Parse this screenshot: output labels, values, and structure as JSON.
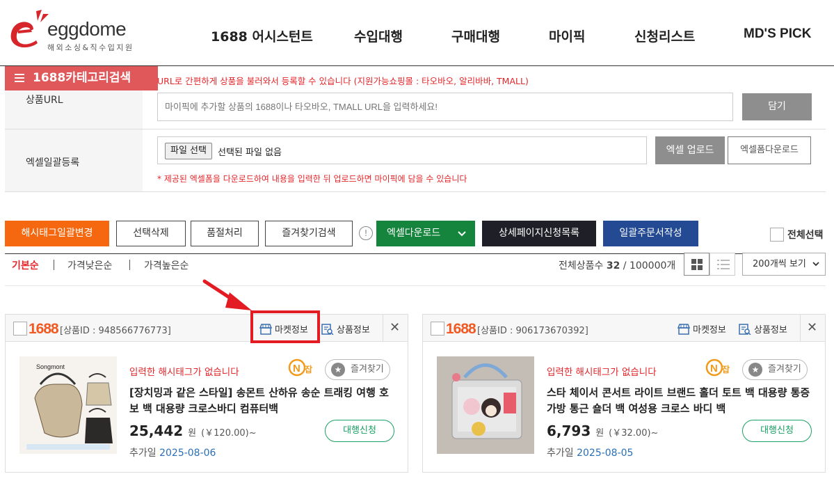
{
  "header": {
    "logo_text": "eggdome",
    "logo_sub": "해외소싱&직수입지원",
    "nav": [
      "1688 어시스턴트",
      "수입대행",
      "구매대행",
      "마이픽",
      "신청리스트",
      "MD'S PICK"
    ]
  },
  "category_button": "1688카테고리검색",
  "url_section": {
    "notice": "URL로 간편하게 상품을 불러와서 등록할 수 있습니다 (지원가능쇼핑몰 : 타오바오, 알리바바, TMALL)",
    "label": "상품URL",
    "placeholder": "마이픽에 추가할 상품의 1688이나 타오바오, TMALL URL을 입력하세요!",
    "button": "담기"
  },
  "excel_section": {
    "label": "엑셀일괄등록",
    "file_button": "파일 선택",
    "file_status": "선택된 파일 없음",
    "upload_button": "엑셀 업로드",
    "form_download_button": "엑셀폼다운로드",
    "notice": "* 제공된 엑셀폼을 다운로드하여 내용을 입력한 뒤 업로드하면 마이픽에 담을 수 있습니다"
  },
  "toolbar": {
    "hashtag_bulk": "해시태그일괄변경",
    "delete_selected": "선택삭제",
    "soldout": "품절처리",
    "fav_search": "즐겨찾기검색",
    "info_icon": "!",
    "excel_download": "엑셀다운로드",
    "detail_list": "상세페이지신청목록",
    "bulk_order": "일괄주문서작성",
    "select_all": "전체선택"
  },
  "sort": {
    "tabs": [
      "기본순",
      "가격낮은순",
      "가격높은순"
    ],
    "total_label": "전체상품수",
    "total_count": "32",
    "total_max": "/ 100000개",
    "per_page": "200개씩 보기"
  },
  "products": [
    {
      "brand": "1688",
      "product_id": "[상품ID : 948566776773]",
      "market_info": "마켓정보",
      "product_info": "상품정보",
      "hashtag_msg": "입력한 해시태그가 없습니다",
      "fav": "즐겨찾기",
      "title": "[장치밍과 같은 스타일] 송몬트 산하유 송순 트래킹 여행 호보 백 대용량 크로스바디 컴퓨터백",
      "price": "25,442",
      "price_unit": "원",
      "price_cny": "(￥120.00)~",
      "order_button": "대행신청",
      "added_label": "추가일",
      "added_date": "2025-08-06",
      "thumb_text": "Songmont"
    },
    {
      "brand": "1688",
      "product_id": "[상품ID : 906173670392]",
      "market_info": "마켓정보",
      "product_info": "상품정보",
      "hashtag_msg": "입력한 해시태그가 없습니다",
      "fav": "즐겨찾기",
      "title": "스타 체이서 콘서트 라이트 브랜드 홀더 토트 백 대용량 통증 가방 통근 숄더 백 여성용 크로스 바디 백",
      "price": "6,793",
      "price_unit": "원",
      "price_cny": "(￥32.00)~",
      "order_button": "대행신청",
      "added_label": "추가일",
      "added_date": "2025-08-05"
    }
  ],
  "colors": {
    "brand_red": "#e0585a",
    "orange": "#f5680f",
    "green": "#15843d",
    "navy": "#234a92",
    "highlight": "#e31b23"
  }
}
